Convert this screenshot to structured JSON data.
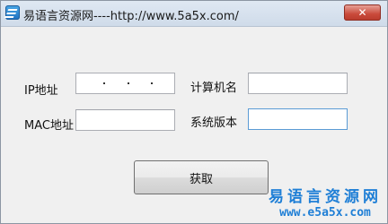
{
  "window": {
    "title": "易语言资源网----http://www.5a5x.com/",
    "close_glyph": "✕",
    "app_icon": "app-logo-icon"
  },
  "form": {
    "ip_label": "IP地址",
    "mac_label": "MAC地址",
    "computer_name_label": "计算机名",
    "system_version_label": "系统版本",
    "ip_value": "",
    "mac_value": "",
    "computer_name_value": "",
    "system_version_value": ""
  },
  "actions": {
    "get_button": "获取"
  },
  "watermark": {
    "name": "易语言资源网",
    "url": "www.e5a5x.com",
    "color": "#1f7fd6"
  }
}
